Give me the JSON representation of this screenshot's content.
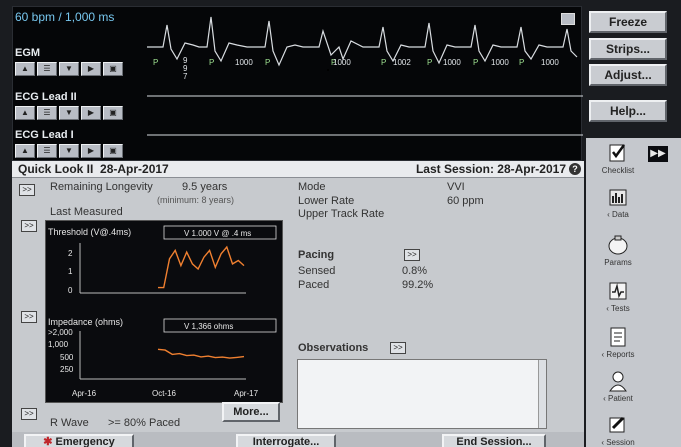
{
  "ecg": {
    "rate_readout": "60 bpm / 1,000 ms",
    "traces": [
      {
        "label": "EGM"
      },
      {
        "label": "ECG Lead II"
      },
      {
        "label": "ECG Lead I"
      }
    ],
    "markers": [
      "P",
      "P",
      "P",
      "P",
      "P",
      "P",
      "P",
      "P"
    ],
    "intervals": [
      "9\n9\n7",
      "1000",
      "1000",
      "1002",
      "1000",
      "1000",
      "1000"
    ]
  },
  "menu": {
    "freeze": "Freeze",
    "strips": "Strips...",
    "adjust": "Adjust...",
    "help": "Help..."
  },
  "sidebar": {
    "items": [
      {
        "label": "Checklist",
        "icon": "checklist-icon"
      },
      {
        "label": "‹ Data",
        "icon": "data-icon"
      },
      {
        "label": "Params",
        "icon": "params-icon"
      },
      {
        "label": "‹ Tests",
        "icon": "tests-icon"
      },
      {
        "label": "‹ Reports",
        "icon": "reports-icon"
      },
      {
        "label": "‹ Patient",
        "icon": "patient-icon"
      },
      {
        "label": "‹ Session",
        "icon": "session-icon"
      }
    ]
  },
  "quick_look": {
    "title": "Quick Look II",
    "date": "28-Apr-2017",
    "last_session": "Last Session: 28-Apr-2017",
    "longevity_label": "Remaining Longevity",
    "longevity_value": "9.5 years",
    "longevity_min": "(minimum: 8 years)",
    "last_measured": "Last Measured",
    "threshold_title": "Threshold (V@.4ms)",
    "threshold_value": "V   1.000 V @ .4 ms",
    "impedance_title": "Impedance (ohms)",
    "impedance_value": "V   1,366 ohms",
    "threshold_ticks": [
      "2",
      "1",
      "0"
    ],
    "impedance_ticks": [
      ">2,000",
      "1,000",
      "500",
      "250"
    ],
    "x_ticks": [
      "Apr-16",
      "Oct-16",
      "Apr-17"
    ],
    "r_wave_label": "R Wave",
    "r_wave_value": ">= 80% Paced",
    "more_button": "More..."
  },
  "params": {
    "mode_label": "Mode",
    "mode_value": "VVI",
    "lower_rate_label": "Lower Rate",
    "lower_rate_value": "60 ppm",
    "upper_rate_label": "Upper Track Rate"
  },
  "pacing": {
    "title": "Pacing",
    "sensed_label": "Sensed",
    "sensed_value": "0.8%",
    "paced_label": "Paced",
    "paced_value": "99.2%"
  },
  "observations": {
    "title": "Observations"
  },
  "bottom": {
    "emergency": "Emergency",
    "interrogate": "Interrogate...",
    "end_session": "End Session..."
  },
  "chart_data": [
    {
      "type": "line",
      "title": "Threshold (V@.4ms)",
      "x": [
        "Oct-16",
        "",
        "",
        "",
        "",
        "",
        "",
        "",
        "",
        "",
        "",
        "",
        "",
        "",
        "",
        "Apr-17"
      ],
      "values": [
        0.2,
        0.2,
        1.9,
        2.4,
        1.5,
        2.3,
        1.6,
        1.3,
        2.0,
        2.4,
        1.4,
        2.2,
        2.6,
        1.6,
        1.8,
        1.5
      ],
      "ylim": [
        0,
        2.6
      ]
    },
    {
      "type": "line",
      "title": "Impedance (ohms)",
      "x": [
        "Oct-16",
        "",
        "",
        "",
        "",
        "",
        "",
        "",
        "",
        "",
        "",
        "",
        "Apr-17"
      ],
      "values": [
        1350,
        1320,
        1150,
        1180,
        1100,
        1120,
        1050,
        1080,
        1020,
        1040,
        1000,
        1030,
        1060
      ],
      "ylim": [
        250,
        2000
      ]
    }
  ]
}
